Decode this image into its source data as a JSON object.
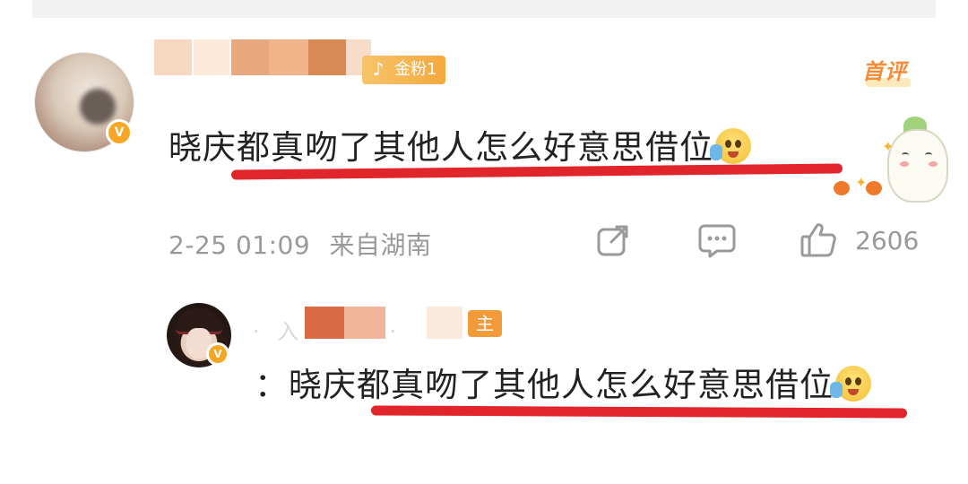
{
  "comment": {
    "fan_badge": "金粉1",
    "first_tag": "首评",
    "text": "晓庆都真吻了其他人怎么好意思借位",
    "timestamp": "2-25 01:09",
    "location": "来自湖南",
    "like_count": "2606"
  },
  "reply": {
    "host_badge": "主",
    "prefix": "：",
    "text": "晓庆都真吻了其他人怎么好意思借位"
  },
  "icons": [
    "share-icon",
    "comment-icon",
    "like-icon",
    "verified-icon",
    "emoji-icon"
  ],
  "colors": {
    "underline": "#e0262a",
    "badge_orange": "#f4a93e",
    "meta_gray": "#999999"
  }
}
